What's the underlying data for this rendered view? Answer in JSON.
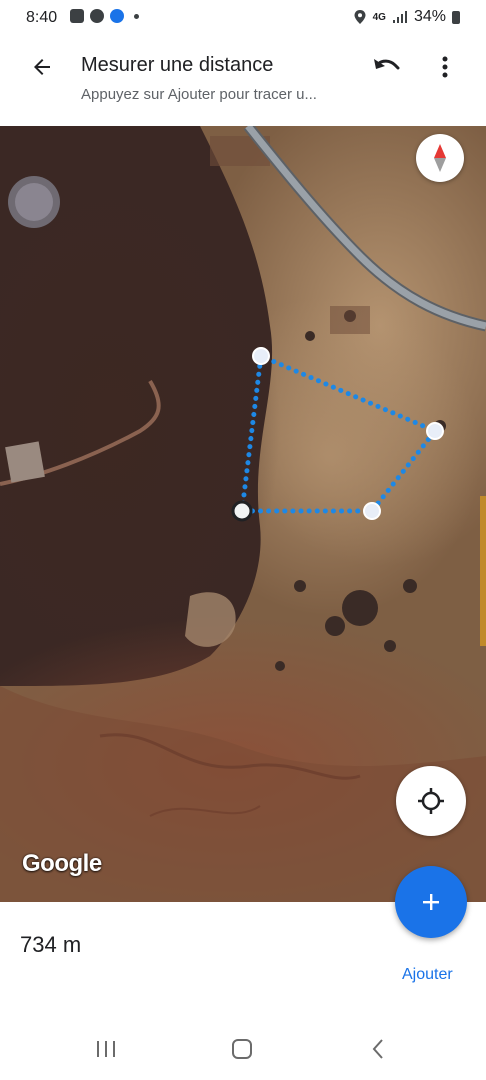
{
  "status_bar": {
    "time": "8:40",
    "network": "4G",
    "battery": "34%",
    "left_icons": [
      "image-icon",
      "facebook-icon",
      "messenger-icon"
    ],
    "right_icons": [
      "location-icon",
      "signal-icon",
      "battery-icon"
    ]
  },
  "app_bar": {
    "title": "Mesurer une distance",
    "subtitle": "Appuyez sur Ajouter pour tracer u..."
  },
  "map": {
    "attribution": "Google",
    "measure_color": "#1e88e5",
    "road_color": "#9aa1a8"
  },
  "measurement": {
    "distance": "734 m"
  },
  "actions": {
    "add_label": "Ajouter",
    "accent": "#1a73e8"
  },
  "nav": {
    "items": [
      "recents-icon",
      "home-icon",
      "back-icon"
    ]
  }
}
